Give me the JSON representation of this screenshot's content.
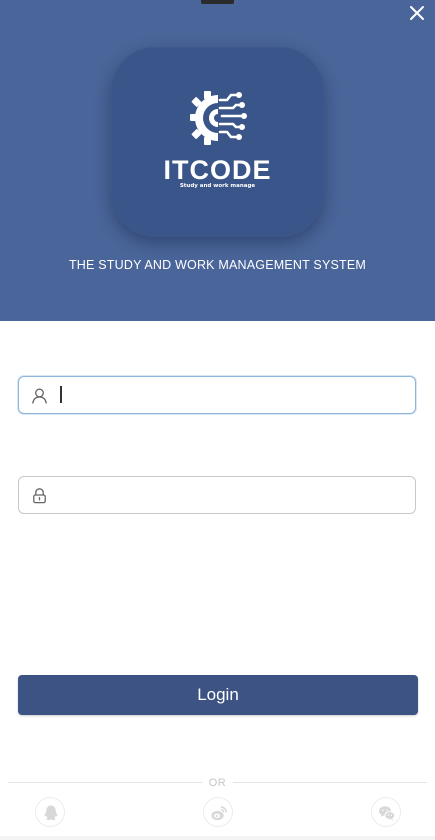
{
  "header": {
    "close_icon": "close-icon",
    "background_color": "#4a6599"
  },
  "logo": {
    "icon": "gear-circuit-icon",
    "wordmark": "ITCODE",
    "tagline": "Study and work manage",
    "tile_color": "#3a5589"
  },
  "subtitle": "THE STUDY AND WORK MANAGEMENT SYSTEM",
  "form": {
    "username": {
      "icon": "user-icon",
      "value": "",
      "placeholder": "",
      "focused": true
    },
    "password": {
      "icon": "lock-icon",
      "value": "",
      "placeholder": ""
    },
    "login_label": "Login",
    "button_color": "#3c5384"
  },
  "divider": {
    "label": "OR"
  },
  "social": [
    {
      "name": "qq",
      "icon": "qq-icon"
    },
    {
      "name": "weibo",
      "icon": "weibo-icon"
    },
    {
      "name": "wechat",
      "icon": "wechat-icon"
    }
  ]
}
